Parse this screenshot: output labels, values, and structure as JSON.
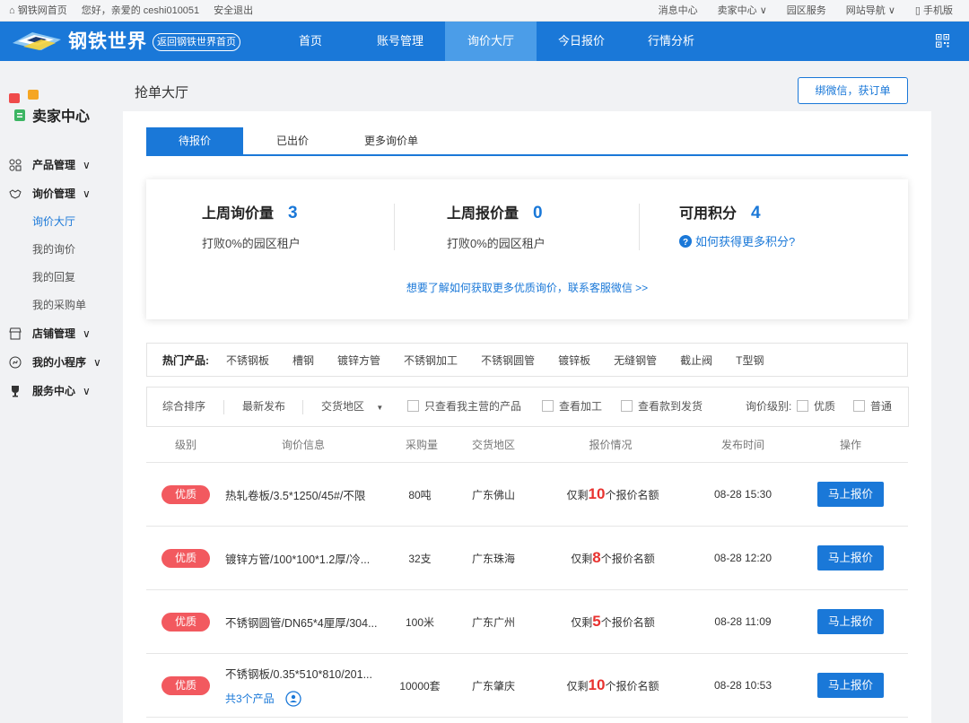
{
  "topbar": {
    "home": "钢铁网首页",
    "greeting": "您好，亲爱的 ceshi010051",
    "logout": "安全退出",
    "messages": "消息中心",
    "seller_center": "卖家中心",
    "park_service": "园区服务",
    "site_nav": "网站导航",
    "mobile": "手机版"
  },
  "nav": {
    "logo_text": "钢铁世界",
    "back": "返回钢铁世界首页",
    "items": [
      "首页",
      "账号管理",
      "询价大厅",
      "今日报价",
      "行情分析"
    ],
    "active_index": 2
  },
  "sidebar": {
    "title": "卖家中心",
    "groups": [
      {
        "label": "产品管理",
        "caret": "∨"
      },
      {
        "label": "询价管理",
        "caret": "∨"
      },
      {
        "label": "店铺管理",
        "caret": "∨"
      },
      {
        "label": "我的小程序",
        "caret": "∨"
      },
      {
        "label": "服务中心",
        "caret": "∨"
      }
    ],
    "sub_items": [
      "询价大厅",
      "我的询价",
      "我的回复",
      "我的采购单"
    ],
    "active_sub": "询价大厅"
  },
  "page": {
    "title": "抢单大厅",
    "wechat_button": "绑微信，获订单"
  },
  "tabs": [
    "待报价",
    "已出价",
    "更多询价单"
  ],
  "stats": {
    "inquiry": {
      "label": "上周询价量",
      "value": "3",
      "sub": "打败0%的园区租户"
    },
    "quote": {
      "label": "上周报价量",
      "value": "0",
      "sub": "打败0%的园区租户"
    },
    "points": {
      "label": "可用积分",
      "value": "4",
      "link": "如何获得更多积分?"
    },
    "more": "想要了解如何获取更多优质询价，联系客服微信 >>"
  },
  "hot": {
    "label": "热门产品:",
    "items": [
      "不锈钢板",
      "槽钢",
      "镀锌方管",
      "不锈钢加工",
      "不锈钢圆管",
      "镀锌板",
      "无缝钢管",
      "截止阀",
      "T型钢"
    ]
  },
  "filter": {
    "sort": "综合排序",
    "latest": "最新发布",
    "region": "交货地区",
    "region_arrow": "▼",
    "only_mine": "只查看我主营的产品",
    "processing": "查看加工",
    "pay_first": "查看款到发货",
    "level_label": "询价级别:",
    "level_premium": "优质",
    "level_normal": "普通"
  },
  "table": {
    "headers": [
      "级别",
      "询价信息",
      "采购量",
      "交货地区",
      "报价情况",
      "发布时间",
      "操作"
    ],
    "quota_prefix": "仅剩",
    "quota_suffix": "个报价名额",
    "rows": [
      {
        "level": "优质",
        "info": "热轧卷板/3.5*1250/45#/不限",
        "qty": "80吨",
        "region": "广东佛山",
        "quota": "10",
        "time": "08-28 15:30",
        "action": "马上报价",
        "extra": ""
      },
      {
        "level": "优质",
        "info": "镀锌方管/100*100*1.2厚/冷...",
        "qty": "32支",
        "region": "广东珠海",
        "quota": "8",
        "time": "08-28 12:20",
        "action": "马上报价",
        "extra": ""
      },
      {
        "level": "优质",
        "info": "不锈钢圆管/DN65*4厘厚/304...",
        "qty": "100米",
        "region": "广东广州",
        "quota": "5",
        "time": "08-28 11:09",
        "action": "马上报价",
        "extra": ""
      },
      {
        "level": "优质",
        "info": "不锈钢板/0.35*510*810/201...",
        "qty": "10000套",
        "region": "广东肇庆",
        "quota": "10",
        "time": "08-28 10:53",
        "action": "马上报价",
        "extra": "共3个产品"
      }
    ]
  },
  "colors": {
    "brand": "#1a78d8",
    "badge": "#f2595f",
    "highlight": "#e8322f"
  }
}
